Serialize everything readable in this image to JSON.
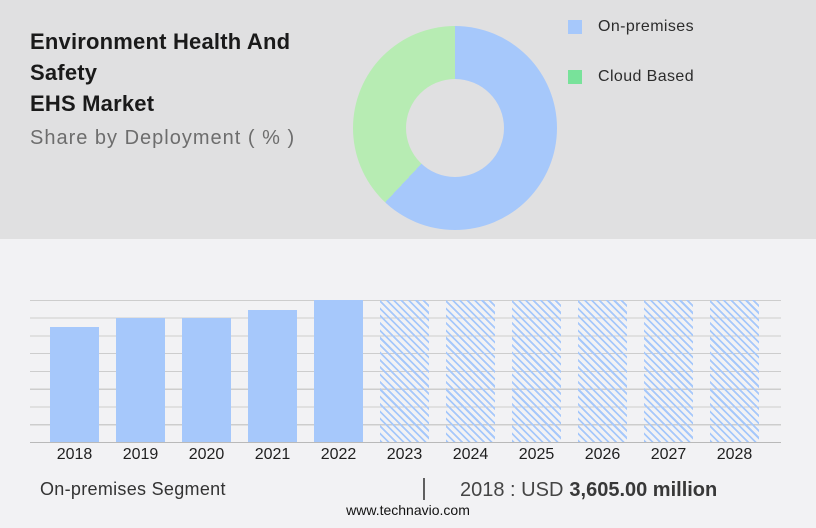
{
  "header": {
    "title_line1": "Environment Health And Safety",
    "title_line2": "EHS Market",
    "subtitle": "Share by Deployment ( % )"
  },
  "legend": {
    "items": [
      {
        "label": "On-premises",
        "color": "#a6c8fb"
      },
      {
        "label": "Cloud Based",
        "color": "#78e29a"
      }
    ]
  },
  "chart_data": [
    {
      "type": "pie",
      "subtype": "donut",
      "title": "Share by Deployment ( % )",
      "series": [
        {
          "name": "On-premises",
          "value_pct": 62,
          "color": "#a6c8fb"
        },
        {
          "name": "Cloud Based",
          "value_pct": 38,
          "color": "#b7ecb3"
        }
      ],
      "start_angle_deg": 0,
      "direction": "clockwise",
      "labels_shown": false,
      "legend_position": "right"
    },
    {
      "type": "bar",
      "categories": [
        "2018",
        "2019",
        "2020",
        "2021",
        "2022",
        "2023",
        "2024",
        "2025",
        "2026",
        "2027",
        "2028"
      ],
      "series": [
        {
          "name": "On-premises Segment",
          "values_pct_of_2022": [
            81,
            87,
            87,
            93,
            100,
            100,
            100,
            100,
            100,
            100,
            100
          ]
        }
      ],
      "hatched_forecast_categories": [
        "2023",
        "2024",
        "2025",
        "2026",
        "2027",
        "2028"
      ],
      "bar_color": "#a6c8fb",
      "grid": "horizontal gridlines, 9 lines, no y-axis labels",
      "known_point_label": "2018 : USD 3,605.00 million",
      "xlabel": "",
      "ylabel": ""
    }
  ],
  "footer": {
    "segment_label": "On-premises Segment",
    "divider": "|",
    "stat_prefix": "2018 : USD",
    "stat_value": "3,605.00 million",
    "website": "www.technavio.com"
  },
  "colors": {
    "blue": "#a6c8fb",
    "donut_green": "#b7ecb3",
    "legend_green": "#78e29a",
    "top_bg": "#e0e0e1",
    "bottom_bg": "#f2f2f4",
    "grid": "#cdcdcd"
  }
}
